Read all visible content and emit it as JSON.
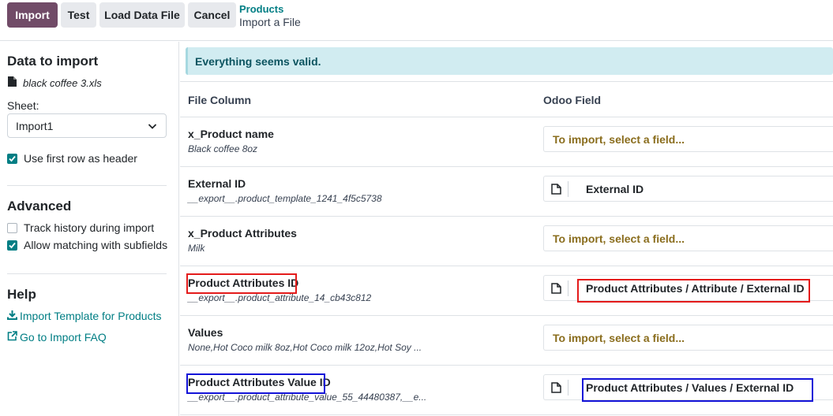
{
  "toolbar": {
    "import_label": "Import",
    "test_label": "Test",
    "load_label": "Load Data File",
    "cancel_label": "Cancel"
  },
  "breadcrumb": {
    "parent": "Products",
    "current": "Import a File"
  },
  "sidebar": {
    "data_heading": "Data to import",
    "file_name": "black coffee 3.xls",
    "sheet_label": "Sheet:",
    "sheet_value": "Import1",
    "first_row_header": "Use first row as header",
    "advanced_heading": "Advanced",
    "track_history": "Track history during import",
    "allow_matching": "Allow matching with subfields",
    "help_heading": "Help",
    "template_link": "Import Template for Products",
    "faq_link": "Go to Import FAQ"
  },
  "main": {
    "alert": "Everything seems valid.",
    "headers": {
      "file_column": "File Column",
      "odoo_field": "Odoo Field"
    },
    "rows": [
      {
        "name": "x_Product name",
        "sample": "Black coffee 8oz",
        "field": "To import, select a field..."
      },
      {
        "name": "External ID",
        "sample": "__export__.product_template_1241_4f5c5738",
        "field": "External ID"
      },
      {
        "name": "x_Product Attributes",
        "sample": "Milk",
        "field": "To import, select a field..."
      },
      {
        "name": "Product Attributes ID",
        "sample": "__export__.product_attribute_14_cb43c812",
        "field": "Product Attributes / Attribute / External ID"
      },
      {
        "name": "Values",
        "sample": "None,Hot Coco milk 8oz,Hot Coco milk 12oz,Hot Soy ...",
        "field": "To import, select a field..."
      },
      {
        "name": "Product Attributes Value ID",
        "sample": "__export__.product_attribute_value_55_44480387,__e...",
        "field": "Product Attributes / Values / External ID"
      }
    ]
  },
  "icons": {
    "file": "file-icon",
    "chevron": "chevron-down-icon",
    "check": "check-icon",
    "download": "download-icon",
    "external": "external-link-icon",
    "field_doc": "document-icon"
  },
  "colors": {
    "primary": "#714b67",
    "accent": "#017e84",
    "alert_bg": "#d1ecf1",
    "placeholder_text": "#8a6d1d",
    "highlight_red": "#e41b1b",
    "highlight_blue": "#1313d8"
  }
}
